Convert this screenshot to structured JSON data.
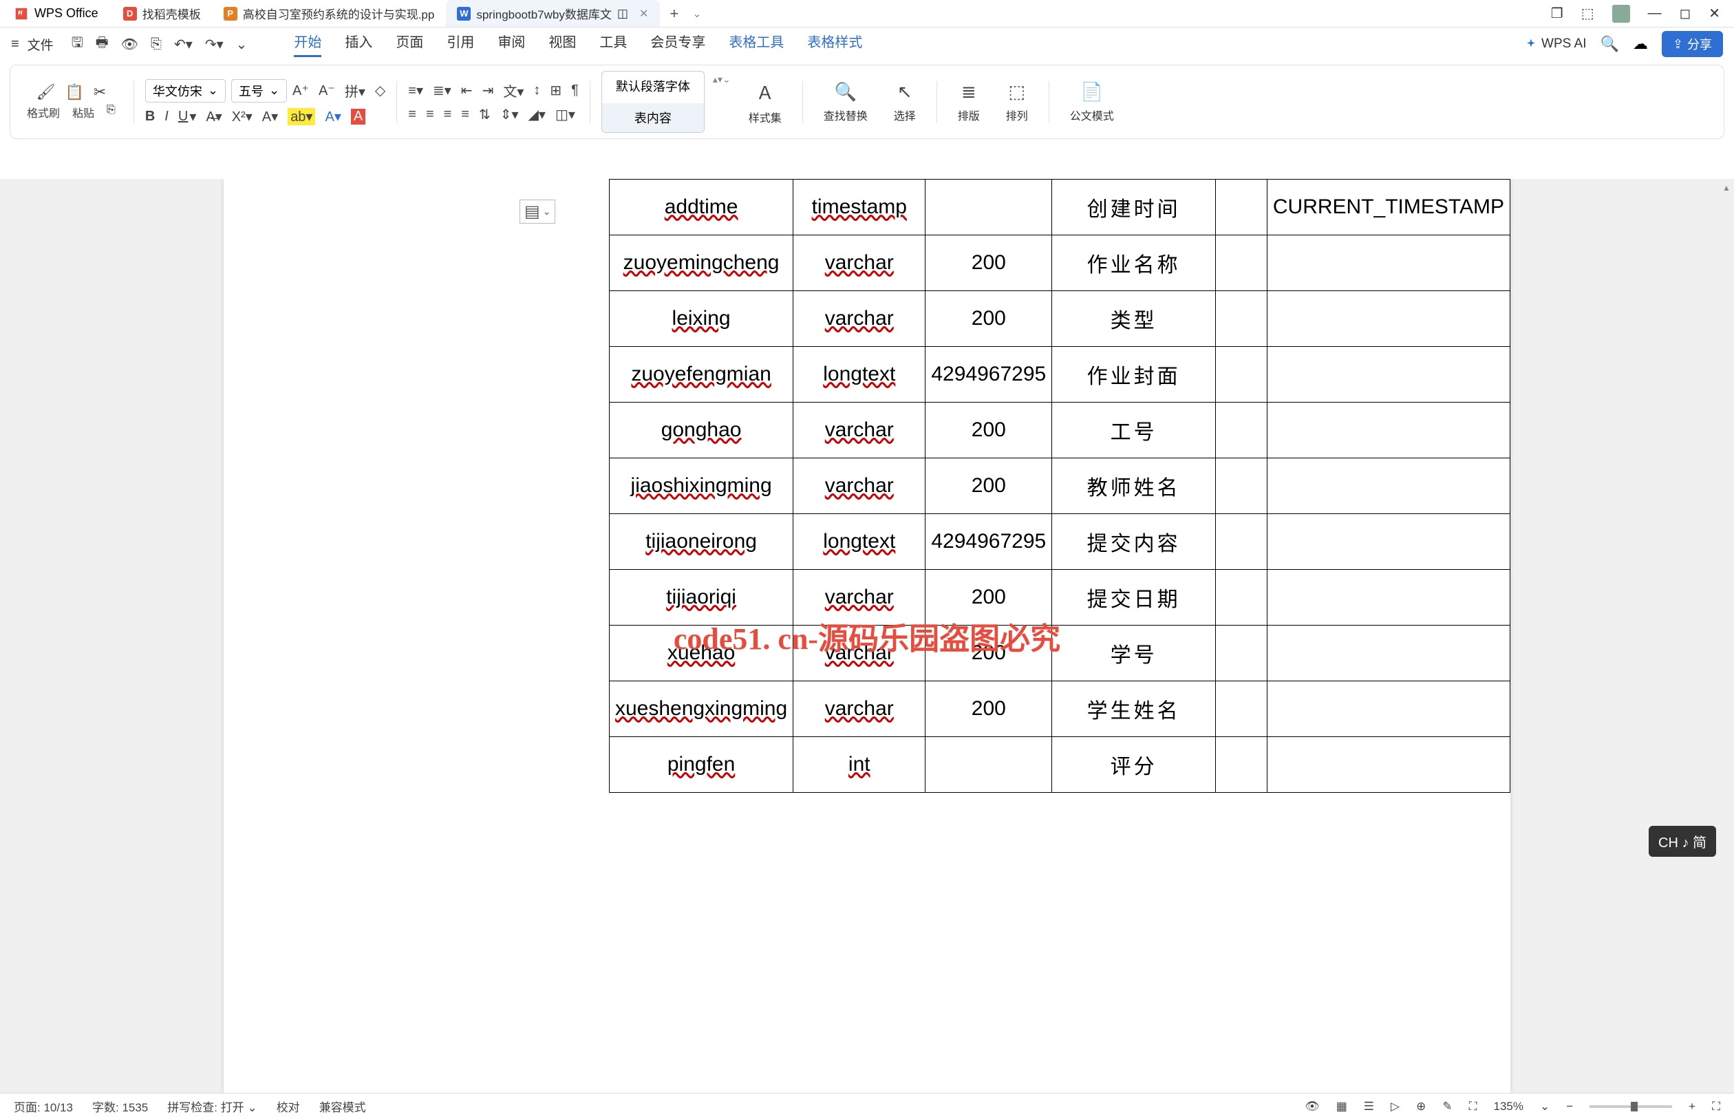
{
  "app": {
    "name": "WPS Office"
  },
  "tabs": [
    {
      "label": "找稻壳模板",
      "iconColor": "red",
      "iconText": "D"
    },
    {
      "label": "高校自习室预约系统的设计与实现.pp",
      "iconColor": "orange",
      "iconText": "P"
    },
    {
      "label": "springbootb7wby数据库文",
      "iconColor": "blue",
      "iconText": "W",
      "active": true
    }
  ],
  "menubar": {
    "file": "文件",
    "items": [
      "开始",
      "插入",
      "页面",
      "引用",
      "审阅",
      "视图",
      "工具",
      "会员专享",
      "表格工具",
      "表格样式"
    ],
    "activeIndex": 0,
    "wpsai": "WPS AI",
    "share": "分享"
  },
  "ribbon": {
    "fmtbrush": "格式刷",
    "paste": "粘贴",
    "fontName": "华文仿宋",
    "fontSize": "五号",
    "styleTab1": "默认段落字体",
    "styleTab2": "表内容",
    "styleSet": "样式集",
    "findReplace": "查找替换",
    "select": "选择",
    "layout": "排版",
    "arrange": "排列",
    "officialMode": "公文模式"
  },
  "statusbar": {
    "page": "页面: 10/13",
    "words": "字数: 1535",
    "spell": "拼写检查: 打开",
    "proof": "校对",
    "compat": "兼容模式",
    "zoom": "135%"
  },
  "watermark": "code51. cn-源码乐园盗图必究",
  "ime": "CH ♪ 简",
  "table": {
    "rows": [
      {
        "c1": "addtime",
        "c2": "timestamp",
        "c3": "",
        "c4": "创建时间",
        "c5": "",
        "c6": "CURRENT_TIMESTAMP"
      },
      {
        "c1": "zuoyemingcheng",
        "c2": "varchar",
        "c3": "200",
        "c4": "作业名称",
        "c5": "",
        "c6": ""
      },
      {
        "c1": "leixing",
        "c2": "varchar",
        "c3": "200",
        "c4": "类型",
        "c5": "",
        "c6": ""
      },
      {
        "c1": "zuoyefengmian",
        "c2": "longtext",
        "c3": "4294967295",
        "c4": "作业封面",
        "c5": "",
        "c6": ""
      },
      {
        "c1": "gonghao",
        "c2": "varchar",
        "c3": "200",
        "c4": "工号",
        "c5": "",
        "c6": ""
      },
      {
        "c1": "jiaoshixingming",
        "c2": "varchar",
        "c3": "200",
        "c4": "教师姓名",
        "c5": "",
        "c6": ""
      },
      {
        "c1": "tijiaoneirong",
        "c2": "longtext",
        "c3": "4294967295",
        "c4": "提交内容",
        "c5": "",
        "c6": ""
      },
      {
        "c1": "tijiaoriqi",
        "c2": "varchar",
        "c3": "200",
        "c4": "提交日期",
        "c5": "",
        "c6": ""
      },
      {
        "c1": "xuehao",
        "c2": "varchar",
        "c3": "200",
        "c4": "学号",
        "c5": "",
        "c6": ""
      },
      {
        "c1": "xueshengxingming",
        "c2": "varchar",
        "c3": "200",
        "c4": "学生姓名",
        "c5": "",
        "c6": ""
      },
      {
        "c1": "pingfen",
        "c2": "int",
        "c3": "",
        "c4": "评分",
        "c5": "",
        "c6": ""
      }
    ]
  }
}
